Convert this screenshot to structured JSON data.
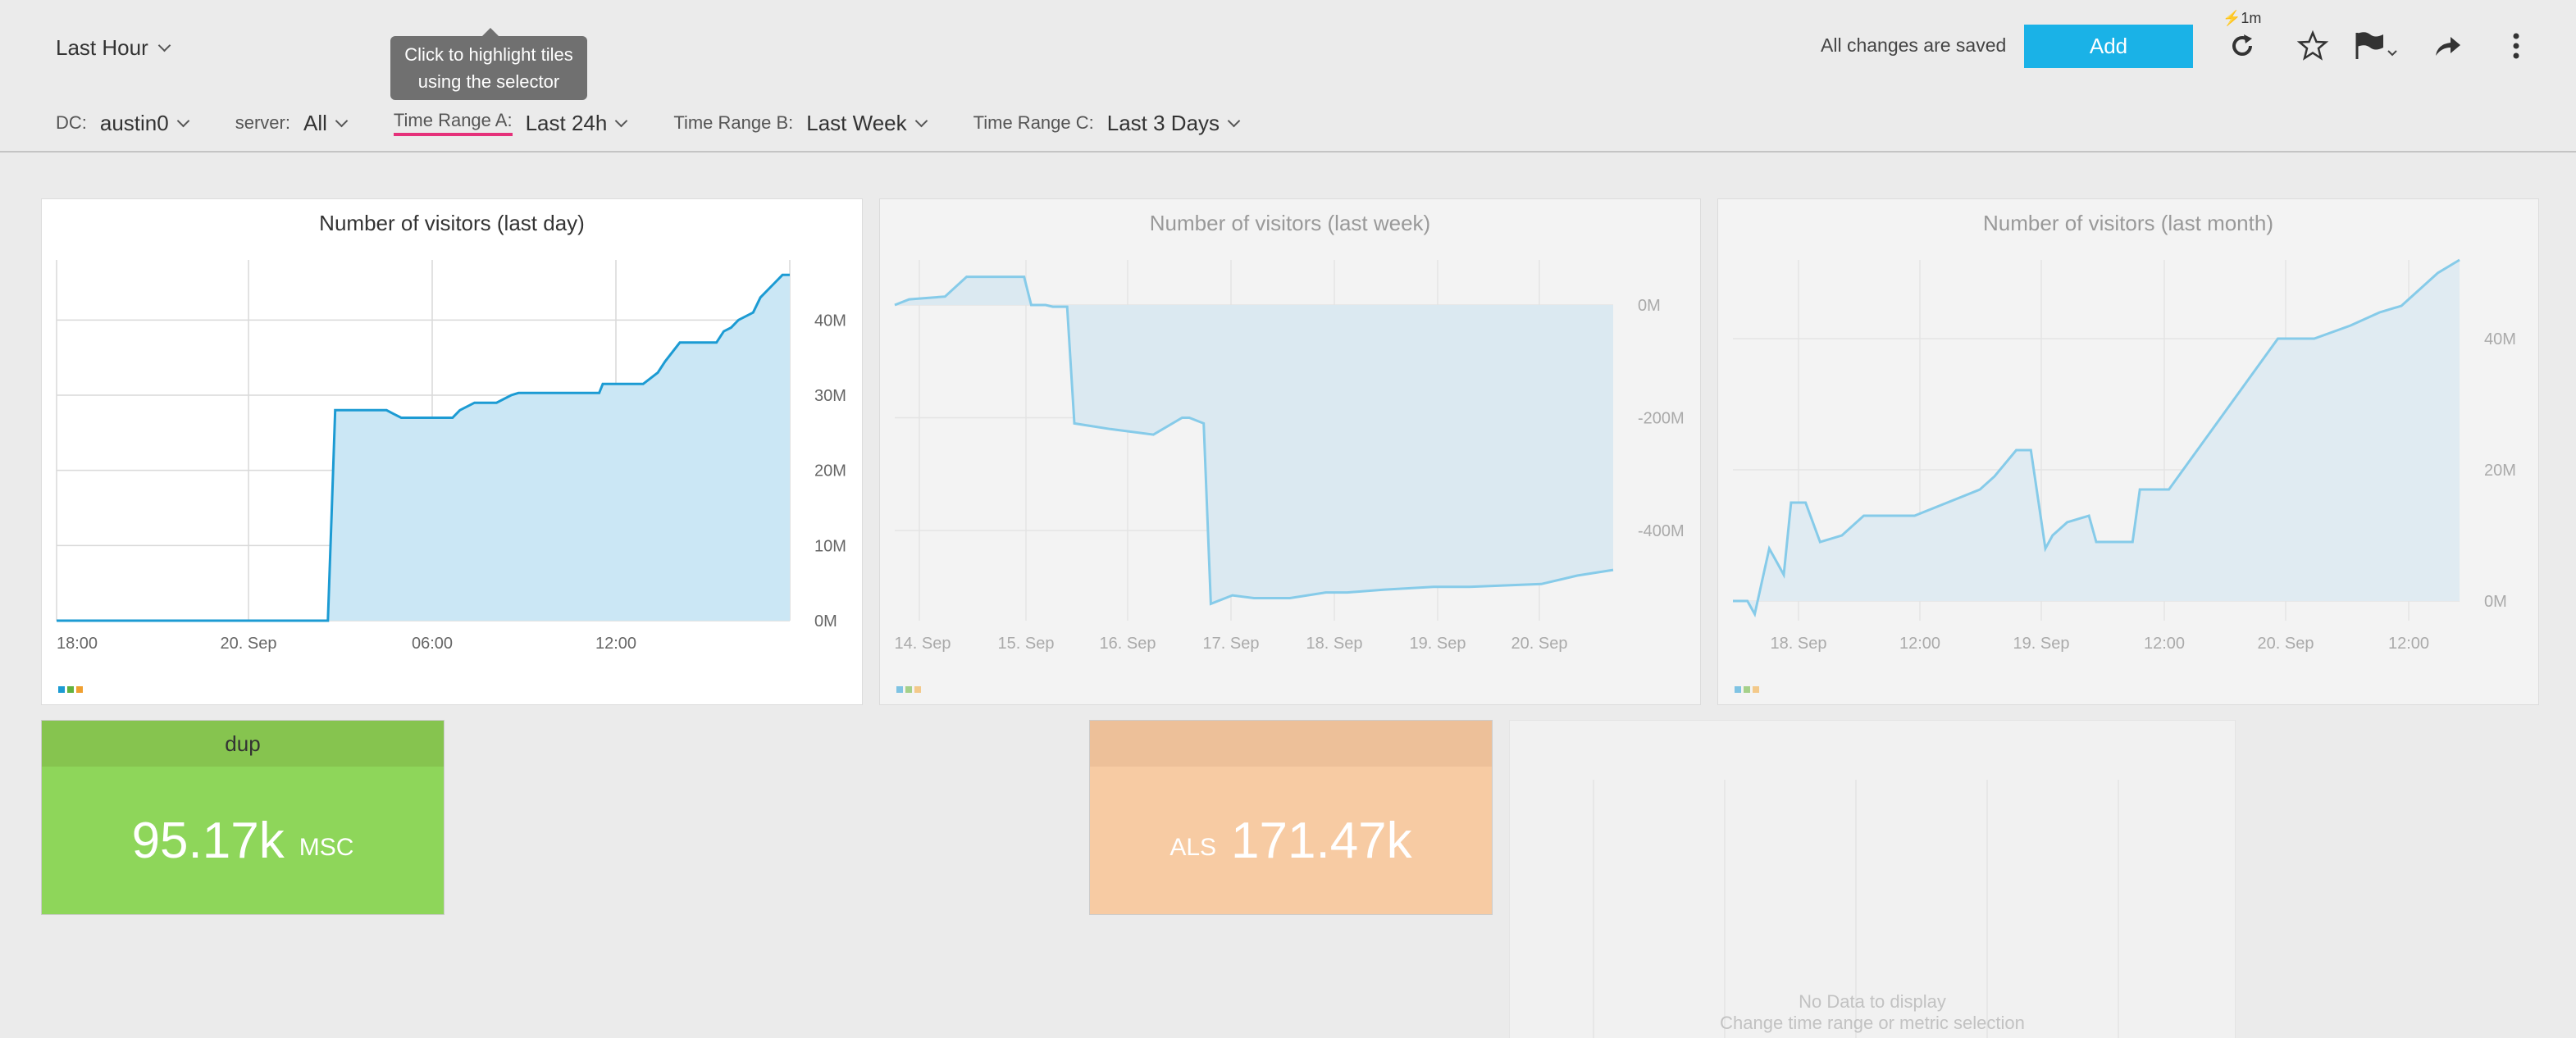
{
  "header": {
    "time_picker": "Last Hour",
    "tooltip_line1": "Click to highlight tiles",
    "tooltip_line2": "using the selector",
    "status": "All changes are saved",
    "add_label": "Add",
    "refresh_interval": "1m",
    "icons": [
      "refresh-icon",
      "star-icon",
      "flag-icon",
      "share-icon",
      "more-vertical-icon"
    ]
  },
  "selectors": [
    {
      "label": "DC:",
      "value": "austin0"
    },
    {
      "label": "server:",
      "value": "All"
    },
    {
      "label": "Time Range A:",
      "value": "Last 24h"
    },
    {
      "label": "Time Range B:",
      "value": "Last Week"
    },
    {
      "label": "Time Range C:",
      "value": "Last 3 Days"
    }
  ],
  "colors": {
    "accent": "#1ab2e7",
    "line": "#1c9bd3",
    "fill": "#cbe7f5",
    "green": "#8ed65a",
    "green_head": "#86c44f",
    "orange": "#f7cba3",
    "orange_head": "#edc099",
    "highlight": "#e5317a"
  },
  "chart_data": [
    {
      "type": "area",
      "title": "Number of visitors (last day)",
      "x_ticks": [
        "18:00",
        "20. Sep",
        "06:00",
        "12:00"
      ],
      "y_ticks": [
        "0M",
        "10M",
        "20M",
        "30M",
        "40M"
      ],
      "ylim": [
        0,
        48
      ],
      "x": [
        0,
        0.37,
        0.375,
        0.38,
        0.45,
        0.46,
        0.47,
        0.54,
        0.55,
        0.57,
        0.6,
        0.62,
        0.63,
        0.67,
        0.74,
        0.745,
        0.8,
        0.82,
        0.83,
        0.85,
        0.87,
        0.9,
        0.91,
        0.92,
        0.93,
        0.95,
        0.96,
        0.98,
        0.99,
        1.0
      ],
      "y": [
        0,
        0,
        14,
        28,
        28,
        27.5,
        27,
        27,
        28,
        29,
        29,
        30,
        30.3,
        30.3,
        30.3,
        31.5,
        31.5,
        33,
        34.5,
        37,
        37,
        37,
        38.5,
        39,
        40,
        41,
        43,
        45,
        46,
        46
      ],
      "legend": [
        "#1c9bd3",
        "#62b23e",
        "#f0a030"
      ]
    },
    {
      "type": "area",
      "title": "Number of visitors (last week)",
      "x_ticks": [
        "14. Sep",
        "15. Sep",
        "16. Sep",
        "17. Sep",
        "18. Sep",
        "19. Sep",
        "20. Sep"
      ],
      "y_ticks": [
        "0M",
        "-200M",
        "-400M"
      ],
      "ylim": [
        -560,
        80
      ],
      "x": [
        0,
        0.02,
        0.07,
        0.1,
        0.18,
        0.19,
        0.21,
        0.22,
        0.24,
        0.25,
        0.3,
        0.36,
        0.4,
        0.41,
        0.43,
        0.44,
        0.47,
        0.5,
        0.55,
        0.6,
        0.63,
        0.68,
        0.75,
        0.8,
        0.9,
        0.95,
        1.0
      ],
      "y": [
        0,
        10,
        15,
        50,
        50,
        0,
        0,
        -3,
        -3,
        -210,
        -220,
        -230,
        -200,
        -200,
        -210,
        -530,
        -515,
        -520,
        -520,
        -510,
        -510,
        -505,
        -500,
        -500,
        -495,
        -480,
        -470
      ],
      "legend": [
        "#7fc3e3",
        "#a5d08a",
        "#f3c98a"
      ]
    },
    {
      "type": "area",
      "title": "Number of visitors (last month)",
      "x_ticks": [
        "18. Sep",
        "12:00",
        "19. Sep",
        "12:00",
        "20. Sep",
        "12:00"
      ],
      "y_ticks": [
        "0M",
        "20M",
        "40M"
      ],
      "ylim": [
        -3,
        52
      ],
      "x": [
        0,
        0.02,
        0.03,
        0.05,
        0.06,
        0.07,
        0.08,
        0.1,
        0.12,
        0.15,
        0.18,
        0.2,
        0.23,
        0.25,
        0.34,
        0.36,
        0.39,
        0.41,
        0.43,
        0.44,
        0.46,
        0.49,
        0.5,
        0.55,
        0.56,
        0.58,
        0.6,
        0.75,
        0.77,
        0.8,
        0.85,
        0.89,
        0.92,
        0.95,
        0.97,
        1.0
      ],
      "y": [
        0,
        0,
        -2,
        8,
        6,
        4,
        15,
        15,
        9,
        10,
        13,
        13,
        13,
        13,
        17,
        19,
        23,
        23,
        8,
        10,
        12,
        13,
        9,
        9,
        17,
        17,
        17,
        40,
        40,
        40,
        42,
        44,
        45,
        48,
        50,
        52
      ],
      "legend": [
        "#7fc3e3",
        "#a5d08a",
        "#f3c98a"
      ]
    }
  ],
  "tiles": {
    "dup": {
      "title": "dup",
      "value": "95.17k",
      "unit": "MSC"
    },
    "als": {
      "title": "",
      "prefix": "ALS",
      "value": "171.47k"
    },
    "empty": {
      "line1": "No Data to display",
      "line2": "Change time range or metric selection"
    }
  }
}
